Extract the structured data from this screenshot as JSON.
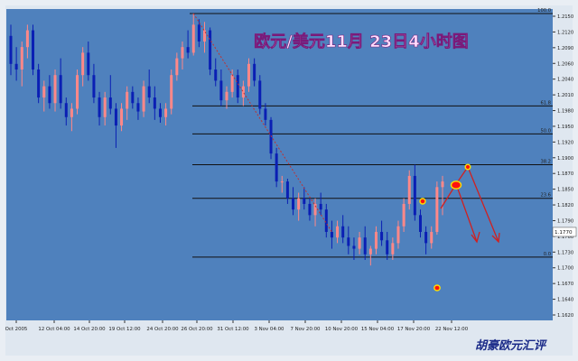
{
  "chart_data": {
    "type": "candlestick",
    "title": "欧元/美元11月 23日4小时图",
    "watermark": "胡豪欧元汇评",
    "colors": {
      "background": "#4f81bd",
      "bull": "#ff8888",
      "bear": "#0a1fb4",
      "fib_line": "#111111",
      "trend_line": "#c03030",
      "arrow": "#d02020",
      "title": "#ffe0ff",
      "marker_fill": "#ff1010",
      "marker_ring": "#ffe000"
    },
    "y_ticks": [
      "1.2150",
      "1.2120",
      "1.2090",
      "1.2060",
      "1.2040",
      "1.2010",
      "1.1980",
      "1.1950",
      "1.1920",
      "1.1900",
      "1.1870",
      "1.1850",
      "1.1820",
      "1.1790",
      "1.1760",
      "1.1730",
      "1.1700",
      "1.1670",
      "1.1640",
      "1.1620"
    ],
    "x_ticks": [
      "Oct 2005",
      "12 Oct 04:00",
      "14 Oct 20:00",
      "19 Oct 12:00",
      "24 Oct 20:00",
      "26 Oct 20:00",
      "31 Oct 12:00",
      "3 Nov 04:00",
      "7 Nov 20:00",
      "10 Nov 20:00",
      "15 Nov 04:00",
      "17 Nov 20:00",
      "22 Nov 12:00"
    ],
    "current_price": "1.1770",
    "fib_levels": [
      {
        "label": "100.0",
        "price": 1.216
      },
      {
        "label": "61.8",
        "price": 1.1995
      },
      {
        "label": "50.0",
        "price": 1.1945
      },
      {
        "label": "38.2",
        "price": 1.189
      },
      {
        "label": "23.6",
        "price": 1.183
      },
      {
        "label": "0.0",
        "price": 1.1725
      }
    ],
    "ohlc": [
      [
        1.212,
        1.214,
        1.205,
        1.207
      ],
      [
        1.207,
        1.21,
        1.204,
        1.206
      ],
      [
        1.206,
        1.211,
        1.203,
        1.21
      ],
      [
        1.21,
        1.214,
        1.208,
        1.213
      ],
      [
        1.213,
        1.214,
        1.205,
        1.206
      ],
      [
        1.206,
        1.207,
        1.2,
        1.201
      ],
      [
        1.201,
        1.204,
        1.1985,
        1.203
      ],
      [
        1.203,
        1.205,
        1.199,
        1.2
      ],
      [
        1.2,
        1.206,
        1.1985,
        1.205
      ],
      [
        1.205,
        1.208,
        1.199,
        1.2
      ],
      [
        1.2,
        1.201,
        1.196,
        1.1975
      ],
      [
        1.1975,
        1.2,
        1.195,
        1.199
      ],
      [
        1.199,
        1.206,
        1.198,
        1.205
      ],
      [
        1.205,
        1.21,
        1.203,
        1.209
      ],
      [
        1.209,
        1.211,
        1.204,
        1.205
      ],
      [
        1.205,
        1.207,
        1.2,
        1.201
      ],
      [
        1.201,
        1.202,
        1.196,
        1.1975
      ],
      [
        1.1975,
        1.202,
        1.196,
        1.201
      ],
      [
        1.201,
        1.205,
        1.198,
        1.199
      ],
      [
        1.199,
        1.2,
        1.192,
        1.196
      ],
      [
        1.196,
        1.2,
        1.195,
        1.199
      ],
      [
        1.199,
        1.203,
        1.197,
        1.202
      ],
      [
        1.202,
        1.203,
        1.199,
        1.2
      ],
      [
        1.2,
        1.201,
        1.197,
        1.1985
      ],
      [
        1.1985,
        1.204,
        1.1975,
        1.203
      ],
      [
        1.203,
        1.206,
        1.2,
        1.201
      ],
      [
        1.201,
        1.203,
        1.197,
        1.199
      ],
      [
        1.199,
        1.2,
        1.1965,
        1.1975
      ],
      [
        1.1975,
        1.2,
        1.196,
        1.199
      ],
      [
        1.199,
        1.206,
        1.198,
        1.205
      ],
      [
        1.205,
        1.209,
        1.204,
        1.208
      ],
      [
        1.208,
        1.211,
        1.206,
        1.21
      ],
      [
        1.21,
        1.213,
        1.208,
        1.209
      ],
      [
        1.209,
        1.216,
        1.2085,
        1.214
      ],
      [
        1.214,
        1.215,
        1.21,
        1.211
      ],
      [
        1.211,
        1.2145,
        1.209,
        1.213
      ],
      [
        1.213,
        1.2135,
        1.205,
        1.206
      ],
      [
        1.206,
        1.208,
        1.203,
        1.204
      ],
      [
        1.204,
        1.206,
        1.1995,
        1.2005
      ],
      [
        1.2005,
        1.203,
        1.199,
        1.202
      ],
      [
        1.202,
        1.206,
        1.201,
        1.205
      ],
      [
        1.205,
        1.206,
        1.2,
        1.201
      ],
      [
        1.201,
        1.204,
        1.1995,
        1.203
      ],
      [
        1.203,
        1.208,
        1.202,
        1.207
      ],
      [
        1.207,
        1.208,
        1.203,
        1.204
      ],
      [
        1.204,
        1.205,
        1.198,
        1.199
      ],
      [
        1.199,
        1.2,
        1.196,
        1.197
      ],
      [
        1.197,
        1.1975,
        1.19,
        1.191
      ],
      [
        1.191,
        1.192,
        1.185,
        1.186
      ],
      [
        1.186,
        1.187,
        1.184,
        1.186
      ],
      [
        1.186,
        1.1865,
        1.182,
        1.183
      ],
      [
        1.183,
        1.185,
        1.18,
        1.181
      ],
      [
        1.181,
        1.184,
        1.179,
        1.183
      ],
      [
        1.183,
        1.185,
        1.181,
        1.182
      ],
      [
        1.182,
        1.183,
        1.179,
        1.18
      ],
      [
        1.18,
        1.183,
        1.178,
        1.182
      ],
      [
        1.182,
        1.184,
        1.18,
        1.181
      ],
      [
        1.181,
        1.182,
        1.176,
        1.177
      ],
      [
        1.177,
        1.179,
        1.174,
        1.176
      ],
      [
        1.176,
        1.179,
        1.175,
        1.178
      ],
      [
        1.178,
        1.18,
        1.175,
        1.176
      ],
      [
        1.176,
        1.178,
        1.173,
        1.1745
      ],
      [
        1.1745,
        1.176,
        1.172,
        1.174
      ],
      [
        1.174,
        1.177,
        1.173,
        1.176
      ],
      [
        1.176,
        1.178,
        1.172,
        1.173
      ],
      [
        1.173,
        1.1745,
        1.171,
        1.174
      ],
      [
        1.174,
        1.178,
        1.173,
        1.177
      ],
      [
        1.177,
        1.179,
        1.1745,
        1.1755
      ],
      [
        1.1755,
        1.177,
        1.172,
        1.173
      ],
      [
        1.173,
        1.176,
        1.172,
        1.175
      ],
      [
        1.175,
        1.179,
        1.174,
        1.178
      ],
      [
        1.178,
        1.183,
        1.177,
        1.182
      ],
      [
        1.182,
        1.188,
        1.181,
        1.187
      ],
      [
        1.187,
        1.189,
        1.179,
        1.18
      ],
      [
        1.18,
        1.181,
        1.176,
        1.177
      ],
      [
        1.177,
        1.178,
        1.173,
        1.175
      ],
      [
        1.175,
        1.178,
        1.174,
        1.177
      ],
      [
        1.177,
        1.186,
        1.1765,
        1.185
      ],
      [
        1.185,
        1.187,
        1.18,
        1.186
      ]
    ]
  }
}
